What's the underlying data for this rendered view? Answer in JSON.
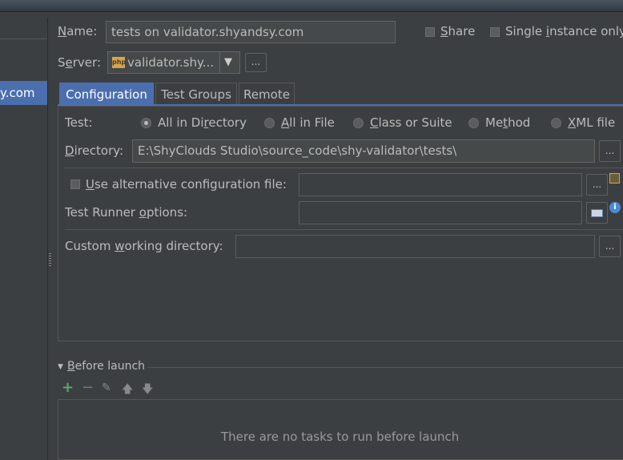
{
  "left_panel": {
    "selected_item": "y.com"
  },
  "header": {
    "name_label_prefix": "",
    "name_label_mnemonic": "N",
    "name_label_rest": "ame:",
    "name_value": "tests on validator.shyandsy.com",
    "share_mnemonic": "S",
    "share_rest": "hare",
    "single_pre": "Single ",
    "single_mnemonic": "i",
    "single_rest": "nstance only",
    "server_pre": "S",
    "server_mnemonic": "e",
    "server_rest": "rver:",
    "server_value": "validator.shy...",
    "server_icon_text": "php",
    "dots": "..."
  },
  "tabs": [
    {
      "label": "Configuration"
    },
    {
      "label": "Test Groups"
    },
    {
      "label": "Remote"
    }
  ],
  "config": {
    "test_label": "Test:",
    "radios": [
      {
        "pre": "All in Di",
        "mn": "r",
        "rest": "ectory",
        "selected": true
      },
      {
        "pre": "",
        "mn": "A",
        "rest": "ll in File",
        "selected": false
      },
      {
        "pre": "",
        "mn": "C",
        "rest": "lass or Suite",
        "selected": false
      },
      {
        "pre": "Me",
        "mn": "t",
        "rest": "hod",
        "selected": false
      },
      {
        "pre": "",
        "mn": "X",
        "rest": "ML file",
        "selected": false
      }
    ],
    "dir_pre": "",
    "dir_mn": "D",
    "dir_rest": "irectory:",
    "dir_value": "E:\\ShyClouds Studio\\source_code\\shy-validator\\tests\\",
    "alt_pre": "",
    "alt_mn": "U",
    "alt_rest": "se alternative configuration file:",
    "runner_pre": "Test Runner ",
    "runner_mn": "o",
    "runner_rest": "ptions:",
    "cwd_pre": "Custom ",
    "cwd_mn": "w",
    "cwd_rest": "orking directory:",
    "dots": "..."
  },
  "before_launch": {
    "title_pre": "",
    "title_mn": "B",
    "title_rest": "efore launch",
    "empty_text": "There are no tasks to run before launch"
  },
  "colors": {
    "accent": "#4b6eaf",
    "background": "#3c3f41",
    "add": "#59a869"
  }
}
